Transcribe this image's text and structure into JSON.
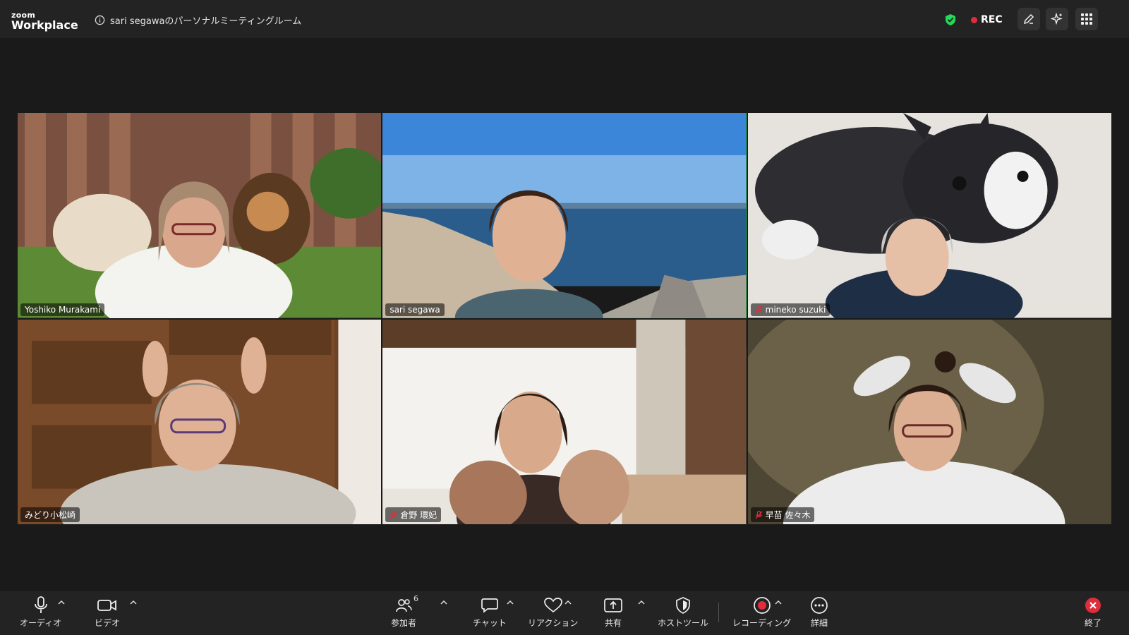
{
  "topbar": {
    "logo_small": "zoom",
    "logo_main": "Workplace",
    "meeting_title": "sari segawaのパーソナルミーティングルーム",
    "rec_label": "REC",
    "colors": {
      "secure": "#23d959",
      "rec": "#e02d3c"
    }
  },
  "participants": [
    {
      "name": "Yoshiko Murakami",
      "muted": false,
      "active": false
    },
    {
      "name": "sari segawa",
      "muted": false,
      "active": true
    },
    {
      "name": "mineko suzuki",
      "muted": true,
      "active": false
    },
    {
      "name": "みどり小松崎",
      "muted": false,
      "active": false
    },
    {
      "name": "倉野 環妃",
      "muted": true,
      "active": false
    },
    {
      "name": "早苗 佐々木",
      "muted": true,
      "active": false
    }
  ],
  "toolbar": {
    "audio": "オーディオ",
    "video": "ビデオ",
    "participants": "参加者",
    "participant_count": "6",
    "chat": "チャット",
    "reactions": "リアクション",
    "share": "共有",
    "host_tools": "ホストツール",
    "recording": "レコーディング",
    "more": "詳細",
    "end": "終了",
    "colors": {
      "end": "#e02d3c",
      "recording": "#e02d3c"
    }
  },
  "icons": [
    "info-icon",
    "shield-check-icon",
    "pen-icon",
    "sparkle-icon",
    "grid-icon",
    "microphone-icon",
    "camera-icon",
    "people-icon",
    "chat-bubble-icon",
    "heart-icon",
    "share-up-icon",
    "shield-icon",
    "record-icon",
    "ellipsis-icon",
    "close-circle-icon",
    "mic-muted-icon",
    "caret-up-icon"
  ]
}
